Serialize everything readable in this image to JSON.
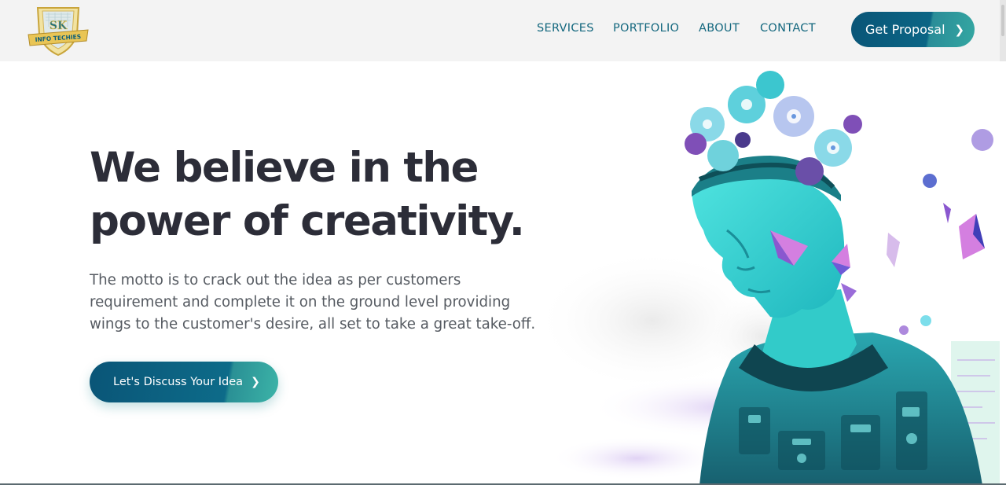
{
  "header": {
    "logo": {
      "icon": "shield-logo-icon",
      "text_top": "SK",
      "text_banner": "INFO TECHIES"
    },
    "nav": {
      "services": "SERVICES",
      "portfolio": "PORTFOLIO",
      "about": "ABOUT",
      "contact": "CONTACT"
    },
    "proposal_button": {
      "label": "Get Proposal",
      "icon": "chevron-right-icon"
    }
  },
  "hero": {
    "headline_line1": "We believe in the",
    "headline_line2": "power of creativity.",
    "motto_line1": "The motto is to crack out the idea as per customers",
    "motto_line2": "requirement and complete it on the ground level providing",
    "motto_line3": "wings to the customer's desire, all set to take a great take-off.",
    "cta_button": {
      "label": "Let's Discuss Your Idea",
      "icon": "chevron-right-icon"
    },
    "illustration": "robot-head-with-flowers-illustration"
  },
  "colors": {
    "nav_text": "#13677e",
    "headline": "#2c2d38",
    "body_text": "#555a61",
    "button_primary": "#0b6585",
    "button_accent": "#34a7a2",
    "robot_teal": "#3fd6d4"
  }
}
